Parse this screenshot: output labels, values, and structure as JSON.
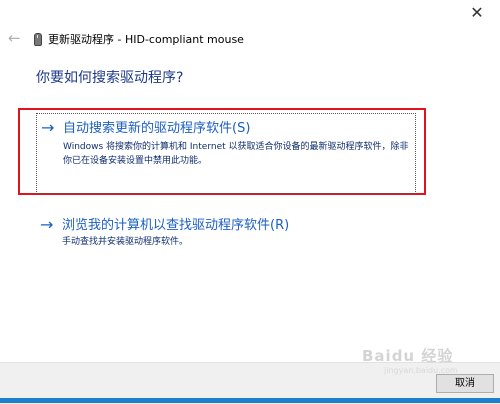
{
  "window": {
    "title": "更新驱动程序 - HID-compliant mouse",
    "close_icon": "✕",
    "back_icon": "←"
  },
  "question": "你要如何搜索驱动程序?",
  "options": [
    {
      "arrow": "→",
      "title": "自动搜索更新的驱动程序软件(S)",
      "description": "Windows 将搜索你的计算机和 Internet 以获取适合你设备的最新驱动程序软件，除非你已在设备安装设置中禁用此功能。",
      "highlighted": true
    },
    {
      "arrow": "→",
      "title": "浏览我的计算机以查找驱动程序软件(R)",
      "description": "手动查找并安装驱动程序软件。",
      "highlighted": false
    }
  ],
  "footer": {
    "cancel_label": "取消"
  },
  "watermark": {
    "text": "Baidu 经验",
    "sub": "jingyan.baidu.com"
  },
  "colors": {
    "link_blue": "#1c5fc4",
    "highlight_red": "#e0141e",
    "heading_blue": "#1e3a8a"
  }
}
